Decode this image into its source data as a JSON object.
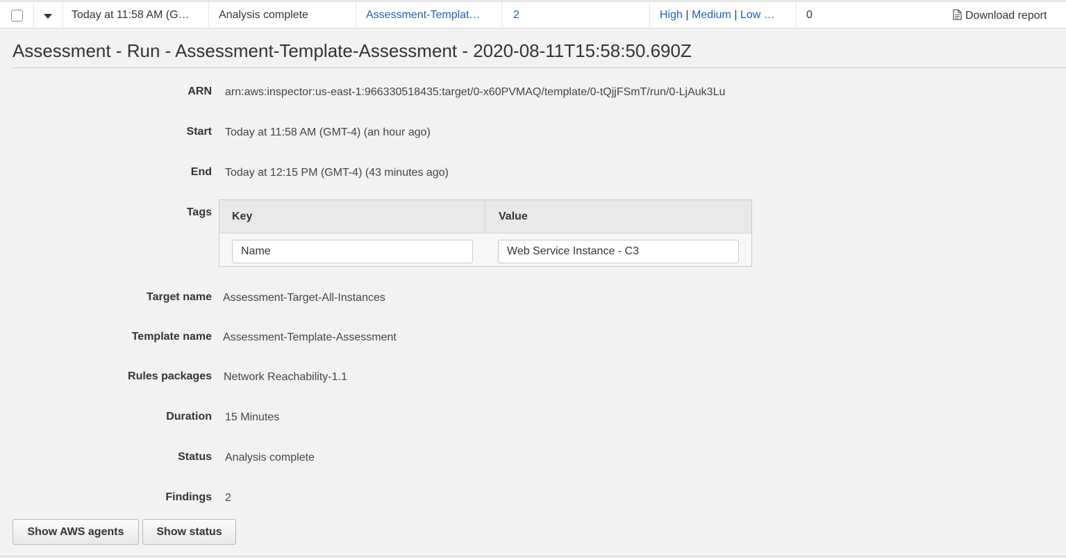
{
  "row": {
    "start": "Today at 11:58 AM (G…",
    "status": "Analysis complete",
    "template": "Assessment-Templat…",
    "findings": "2",
    "severity_high": "High",
    "severity_medium": "Medium",
    "severity_low": "Low …",
    "sep": "|",
    "count": "0",
    "download_label": "Download report"
  },
  "title": "Assessment - Run - Assessment-Template-Assessment - 2020-08-11T15:58:50.690Z",
  "details": {
    "arn_label": "ARN",
    "arn": "arn:aws:inspector:us-east-1:966330518435:target/0-x60PVMAQ/template/0-tQjjFSmT/run/0-LjAuk3Lu",
    "start_label": "Start",
    "start": "Today at 11:58 AM (GMT-4) (an hour ago)",
    "end_label": "End",
    "end": "Today at 12:15 PM (GMT-4) (43 minutes ago)",
    "tags_label": "Tags",
    "tags": {
      "key_header": "Key",
      "value_header": "Value",
      "key": "Name",
      "value": "Web Service Instance - C3"
    },
    "target_label": "Target name",
    "target": "Assessment-Target-All-Instances",
    "template_label": "Template name",
    "template": "Assessment-Template-Assessment",
    "rules_label": "Rules packages",
    "rules": "Network Reachability-1.1",
    "duration_label": "Duration",
    "duration": "15 Minutes",
    "status_label": "Status",
    "status": "Analysis complete",
    "findings_label": "Findings",
    "findings": "2"
  },
  "buttons": {
    "show_agents": "Show AWS agents",
    "show_status": "Show status"
  },
  "icons": {
    "expand": "chevron-down-icon",
    "download": "document-icon"
  },
  "colors": {
    "link": "#1f5fb8",
    "background": "#f2f2f2"
  }
}
